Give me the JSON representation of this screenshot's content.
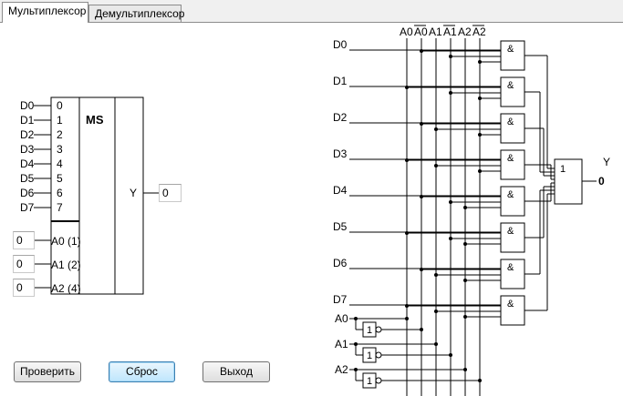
{
  "tabs": [
    {
      "label": "Мультиплексор",
      "active": true
    },
    {
      "label": "Демультиплексор",
      "active": false
    }
  ],
  "ms_block": {
    "title": "MS",
    "data_inputs": [
      {
        "label": "D0",
        "pin": "0"
      },
      {
        "label": "D1",
        "pin": "1"
      },
      {
        "label": "D2",
        "pin": "2"
      },
      {
        "label": "D3",
        "pin": "3"
      },
      {
        "label": "D4",
        "pin": "4"
      },
      {
        "label": "D5",
        "pin": "5"
      },
      {
        "label": "D6",
        "pin": "6"
      },
      {
        "label": "D7",
        "pin": "7"
      }
    ],
    "address_inputs": [
      {
        "pin": "A0 (1)",
        "value": "0"
      },
      {
        "pin": "A1 (2)",
        "value": "0"
      },
      {
        "pin": "A2 (4)",
        "value": "0"
      }
    ],
    "output_label": "Y",
    "output_value": "0"
  },
  "buttons": {
    "check": "Проверить",
    "reset": "Сброс",
    "exit": "Выход"
  },
  "circuit": {
    "bus_labels": [
      "A0",
      "A0",
      "A1",
      "A1",
      "A2",
      "A2"
    ],
    "bus_inverted": [
      false,
      true,
      false,
      true,
      false,
      true
    ],
    "data_labels": [
      "D0",
      "D1",
      "D2",
      "D3",
      "D4",
      "D5",
      "D6",
      "D7"
    ],
    "address_labels": [
      "A0",
      "A1",
      "A2"
    ],
    "and_symbol": "&",
    "or_symbol": "1",
    "not_symbol": "1",
    "output_label": "Y",
    "output_value": "0"
  }
}
